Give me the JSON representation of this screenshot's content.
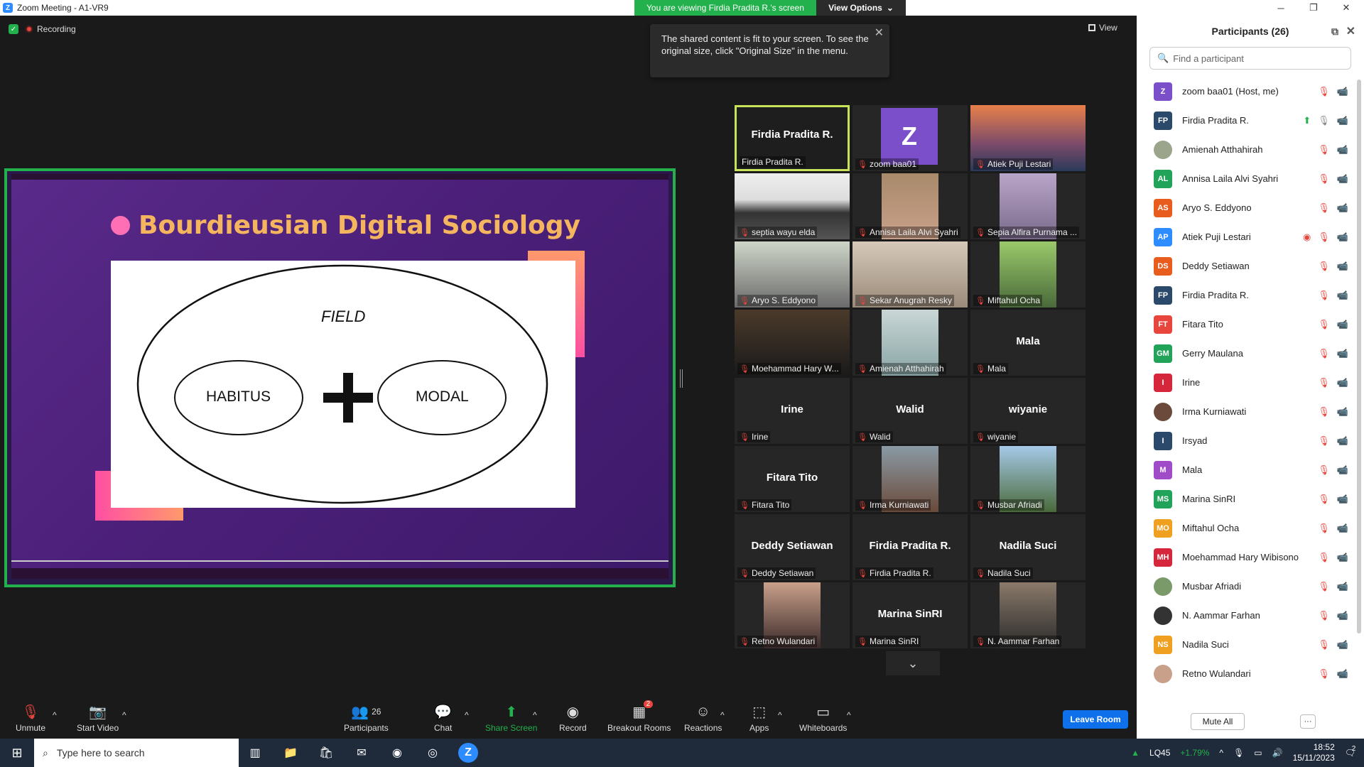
{
  "window": {
    "title": "Zoom Meeting - A1-VR9",
    "viewing_msg": "You are viewing Firdia Pradita R.'s screen",
    "view_options": "View Options"
  },
  "meeting": {
    "recording": "Recording",
    "view_label": "View",
    "tooltip": "The shared content is fit to your screen. To see the original size, click \"Original Size\" in the menu."
  },
  "slide": {
    "title": "Bourdieusian Digital Sociology",
    "field": "FIELD",
    "habitus": "HABITUS",
    "modal": "MODAL"
  },
  "tiles": [
    {
      "big": "Firdia Pradita R.",
      "name": "Firdia Pradita R.",
      "muted": false,
      "active": true
    },
    {
      "big": "",
      "name": "zoom baa01",
      "muted": true,
      "avatar": "Z"
    },
    {
      "big": "",
      "name": "Atiek Puji Lestari",
      "muted": true,
      "photo": "sunset"
    },
    {
      "big": "",
      "name": "septia wayu elda",
      "muted": true,
      "photo": "hijab-white"
    },
    {
      "big": "",
      "name": "Annisa Laila Alvi Syahri",
      "muted": true,
      "photo": "room"
    },
    {
      "big": "",
      "name": "Sepia Alfira Purnama ...",
      "muted": true,
      "photo": "blur"
    },
    {
      "big": "",
      "name": "Aryo S. Eddyono",
      "muted": true,
      "photo": "man"
    },
    {
      "big": "",
      "name": "Sekar Anugrah Resky",
      "muted": true,
      "photo": "hijab"
    },
    {
      "big": "",
      "name": "Miftahul Ocha",
      "muted": true,
      "photo": "plant"
    },
    {
      "big": "",
      "name": "Moehammad Hary W...",
      "muted": true,
      "photo": "dark"
    },
    {
      "big": "",
      "name": "Amienah Atthahirah",
      "muted": true,
      "photo": "group"
    },
    {
      "big": "Mala",
      "name": "Mala",
      "muted": true
    },
    {
      "big": "Irine",
      "name": "Irine",
      "muted": true
    },
    {
      "big": "Walid",
      "name": "Walid",
      "muted": true
    },
    {
      "big": "wiyanie",
      "name": "wiyanie",
      "muted": true
    },
    {
      "big": "Fitara Tito",
      "name": "Fitara Tito",
      "muted": true
    },
    {
      "big": "",
      "name": "Irma Kurniawati",
      "muted": true,
      "photo": "street"
    },
    {
      "big": "",
      "name": "Musbar Afriadi",
      "muted": true,
      "photo": "outdoor"
    },
    {
      "big": "Deddy Setiawan",
      "name": "Deddy Setiawan",
      "muted": true
    },
    {
      "big": "Firdia Pradita R.",
      "name": "Firdia Pradita R.",
      "muted": true
    },
    {
      "big": "Nadila Suci",
      "name": "Nadila Suci",
      "muted": true
    },
    {
      "big": "",
      "name": "Retno Wulandari",
      "muted": true,
      "photo": "woman"
    },
    {
      "big": "Marina SinRI",
      "name": "Marina SinRI",
      "muted": true
    },
    {
      "big": "",
      "name": "N. Aammar Farhan",
      "muted": true,
      "photo": "man-dark"
    }
  ],
  "toolbar": {
    "unmute": "Unmute",
    "start_video": "Start Video",
    "participants": "Participants",
    "participants_count": "26",
    "chat": "Chat",
    "share_screen": "Share Screen",
    "record": "Record",
    "breakout": "Breakout Rooms",
    "breakout_badge": "2",
    "reactions": "Reactions",
    "apps": "Apps",
    "whiteboards": "Whiteboards",
    "leave": "Leave Room"
  },
  "panel": {
    "title": "Participants (26)",
    "search_placeholder": "Find a participant",
    "mute_all": "Mute All",
    "more": "···",
    "participants": [
      {
        "initials": "Z",
        "name": "zoom baa01 (Host, me)",
        "color": "#7b4fc9",
        "cam": false
      },
      {
        "initials": "FP",
        "name": "Firdia Pradita R.",
        "color": "#2b4a6b",
        "cam": false,
        "sharing": true,
        "mic_on": true
      },
      {
        "initials": "",
        "name": "Amienah Atthahirah",
        "color": "#9aa58b",
        "cam": false,
        "photo": true
      },
      {
        "initials": "AL",
        "name": "Annisa Laila Alvi Syahri",
        "color": "#22a35a",
        "cam": true
      },
      {
        "initials": "AS",
        "name": "Aryo S. Eddyono",
        "color": "#e85d1e",
        "cam": true
      },
      {
        "initials": "AP",
        "name": "Atiek Puji Lestari",
        "color": "#2d8cff",
        "cam": true,
        "rec": true
      },
      {
        "initials": "DS",
        "name": "Deddy Setiawan",
        "color": "#e85d1e",
        "cam": false
      },
      {
        "initials": "FP",
        "name": "Firdia Pradita R.",
        "color": "#2b4a6b",
        "cam": false
      },
      {
        "initials": "FT",
        "name": "Fitara Tito",
        "color": "#e8453c",
        "cam": false
      },
      {
        "initials": "GM",
        "name": "Gerry Maulana",
        "color": "#22a35a",
        "cam": false
      },
      {
        "initials": "I",
        "name": "Irine",
        "color": "#d6263b",
        "cam": false
      },
      {
        "initials": "",
        "name": "Irma Kurniawati",
        "color": "#6b4a3b",
        "cam": false,
        "photo": true
      },
      {
        "initials": "I",
        "name": "Irsyad",
        "color": "#2b4a6b",
        "cam": false
      },
      {
        "initials": "M",
        "name": "Mala",
        "color": "#a04cc9",
        "cam": false
      },
      {
        "initials": "MS",
        "name": "Marina SinRI",
        "color": "#22a35a",
        "cam": false
      },
      {
        "initials": "MO",
        "name": "Miftahul Ocha",
        "color": "#f0a020",
        "cam": true
      },
      {
        "initials": "MH",
        "name": "Moehammad Hary Wibisono",
        "color": "#d6263b",
        "cam": true
      },
      {
        "initials": "",
        "name": "Musbar Afriadi",
        "color": "#7a9a6a",
        "cam": false,
        "photo": true
      },
      {
        "initials": "",
        "name": "N. Aammar Farhan",
        "color": "#333333",
        "cam": false,
        "photo": true
      },
      {
        "initials": "NS",
        "name": "Nadila Suci",
        "color": "#f0a020",
        "cam": false
      },
      {
        "initials": "",
        "name": "Retno Wulandari",
        "color": "#c9a08a",
        "cam": false,
        "photo": true
      }
    ]
  },
  "taskbar": {
    "search_placeholder": "Type here to search",
    "stock": "LQ45",
    "stock_change": "+1.79%",
    "time": "18:52",
    "date": "15/11/2023",
    "notifications": "2"
  }
}
